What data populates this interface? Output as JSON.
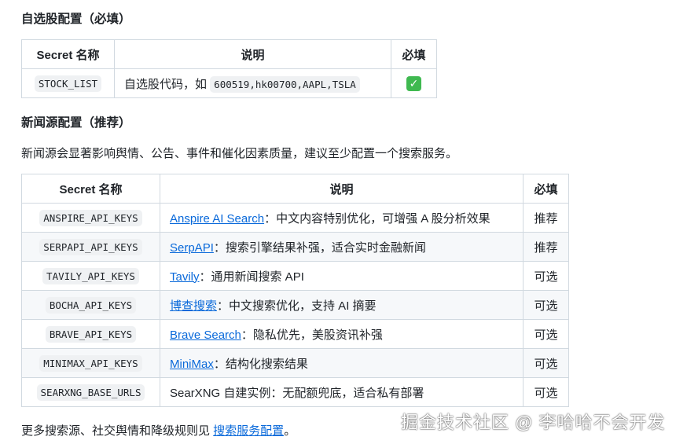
{
  "section1": {
    "title": "自选股配置（必填）",
    "headers": [
      "Secret 名称",
      "说明",
      "必填"
    ],
    "rows": [
      {
        "name": "STOCK_LIST",
        "desc": "自选股代码，如 ",
        "code": "600519,hk00700,AAPL,TSLA",
        "required": "check-icon"
      }
    ]
  },
  "section2": {
    "title": "新闻源配置（推荐）",
    "intro": "新闻源会显著影响舆情、公告、事件和催化因素质量，建议至少配置一个搜索服务。",
    "headers": [
      "Secret 名称",
      "说明",
      "必填"
    ],
    "rows": [
      {
        "name": "ANSPIRE_API_KEYS",
        "link": "Anspire AI Search",
        "desc": "：中文内容特别优化，可增强 A 股分析效果",
        "required": "推荐"
      },
      {
        "name": "SERPAPI_API_KEYS",
        "link": "SerpAPI",
        "desc": "：搜索引擎结果补强，适合实时金融新闻",
        "required": "推荐"
      },
      {
        "name": "TAVILY_API_KEYS",
        "link": "Tavily",
        "desc": "：通用新闻搜索 API",
        "required": "可选"
      },
      {
        "name": "BOCHA_API_KEYS",
        "link": "博查搜索",
        "desc": "：中文搜索优化，支持 AI 摘要",
        "required": "可选"
      },
      {
        "name": "BRAVE_API_KEYS",
        "link": "Brave Search",
        "desc": "：隐私优先，美股资讯补强",
        "required": "可选"
      },
      {
        "name": "MINIMAX_API_KEYS",
        "link": "MiniMax",
        "desc": "：结构化搜索结果",
        "required": "可选"
      },
      {
        "name": "SEARXNG_BASE_URLS",
        "link": null,
        "desc": "SearXNG 自建实例：无配额兜底，适合私有部署",
        "required": "可选"
      }
    ]
  },
  "footer": {
    "text": "更多搜索源、社交舆情和降级规则见 ",
    "link": "搜索服务配置",
    "end": "。"
  },
  "watermark": "掘金技术社区 @ 李哈哈不会开发"
}
